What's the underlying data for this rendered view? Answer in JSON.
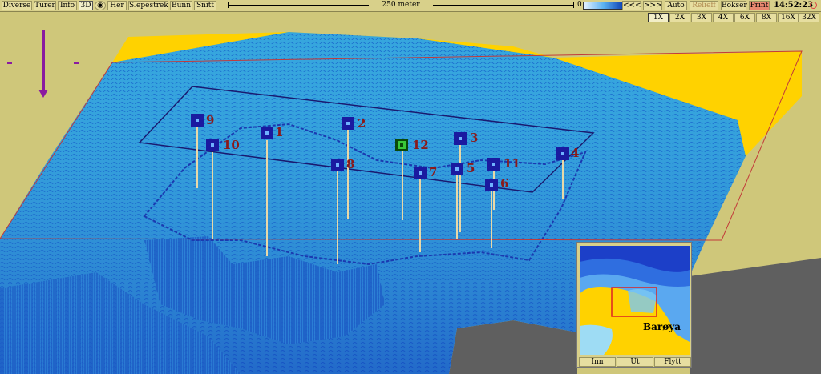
{
  "toolbar": {
    "menus": [
      "Diverse",
      "Turer",
      "Info",
      "3D"
    ],
    "menus2": [
      "Her",
      "Slepestrek",
      "Bunn",
      "Snitt"
    ],
    "scale_label": "250 meter",
    "depth_min": "0",
    "depth_max": "300",
    "nav_buttons": [
      "<<<",
      ">>>",
      "Auto",
      "Relieff",
      "Bokser",
      "Print"
    ],
    "clock": "14:52:23"
  },
  "zoom": [
    "1X",
    "2X",
    "3X",
    "4X",
    "6X",
    "8X",
    "16X",
    "32X"
  ],
  "markers": [
    "9",
    "10",
    "1",
    "2",
    "8",
    "12",
    "7",
    "3",
    "5",
    "11",
    "6",
    "4"
  ],
  "minimap": {
    "place_name": "Barøya",
    "buttons": [
      "Inn",
      "Ut",
      "Flytt"
    ]
  },
  "colors": {
    "sea": "#3aa9e0",
    "deep": "#0b36c0",
    "land": "#ffd200",
    "toolbar": "#d8d08a",
    "marker": "#1a1aa0",
    "marker_active": "#3ac83a",
    "label": "#8a1a1a"
  }
}
